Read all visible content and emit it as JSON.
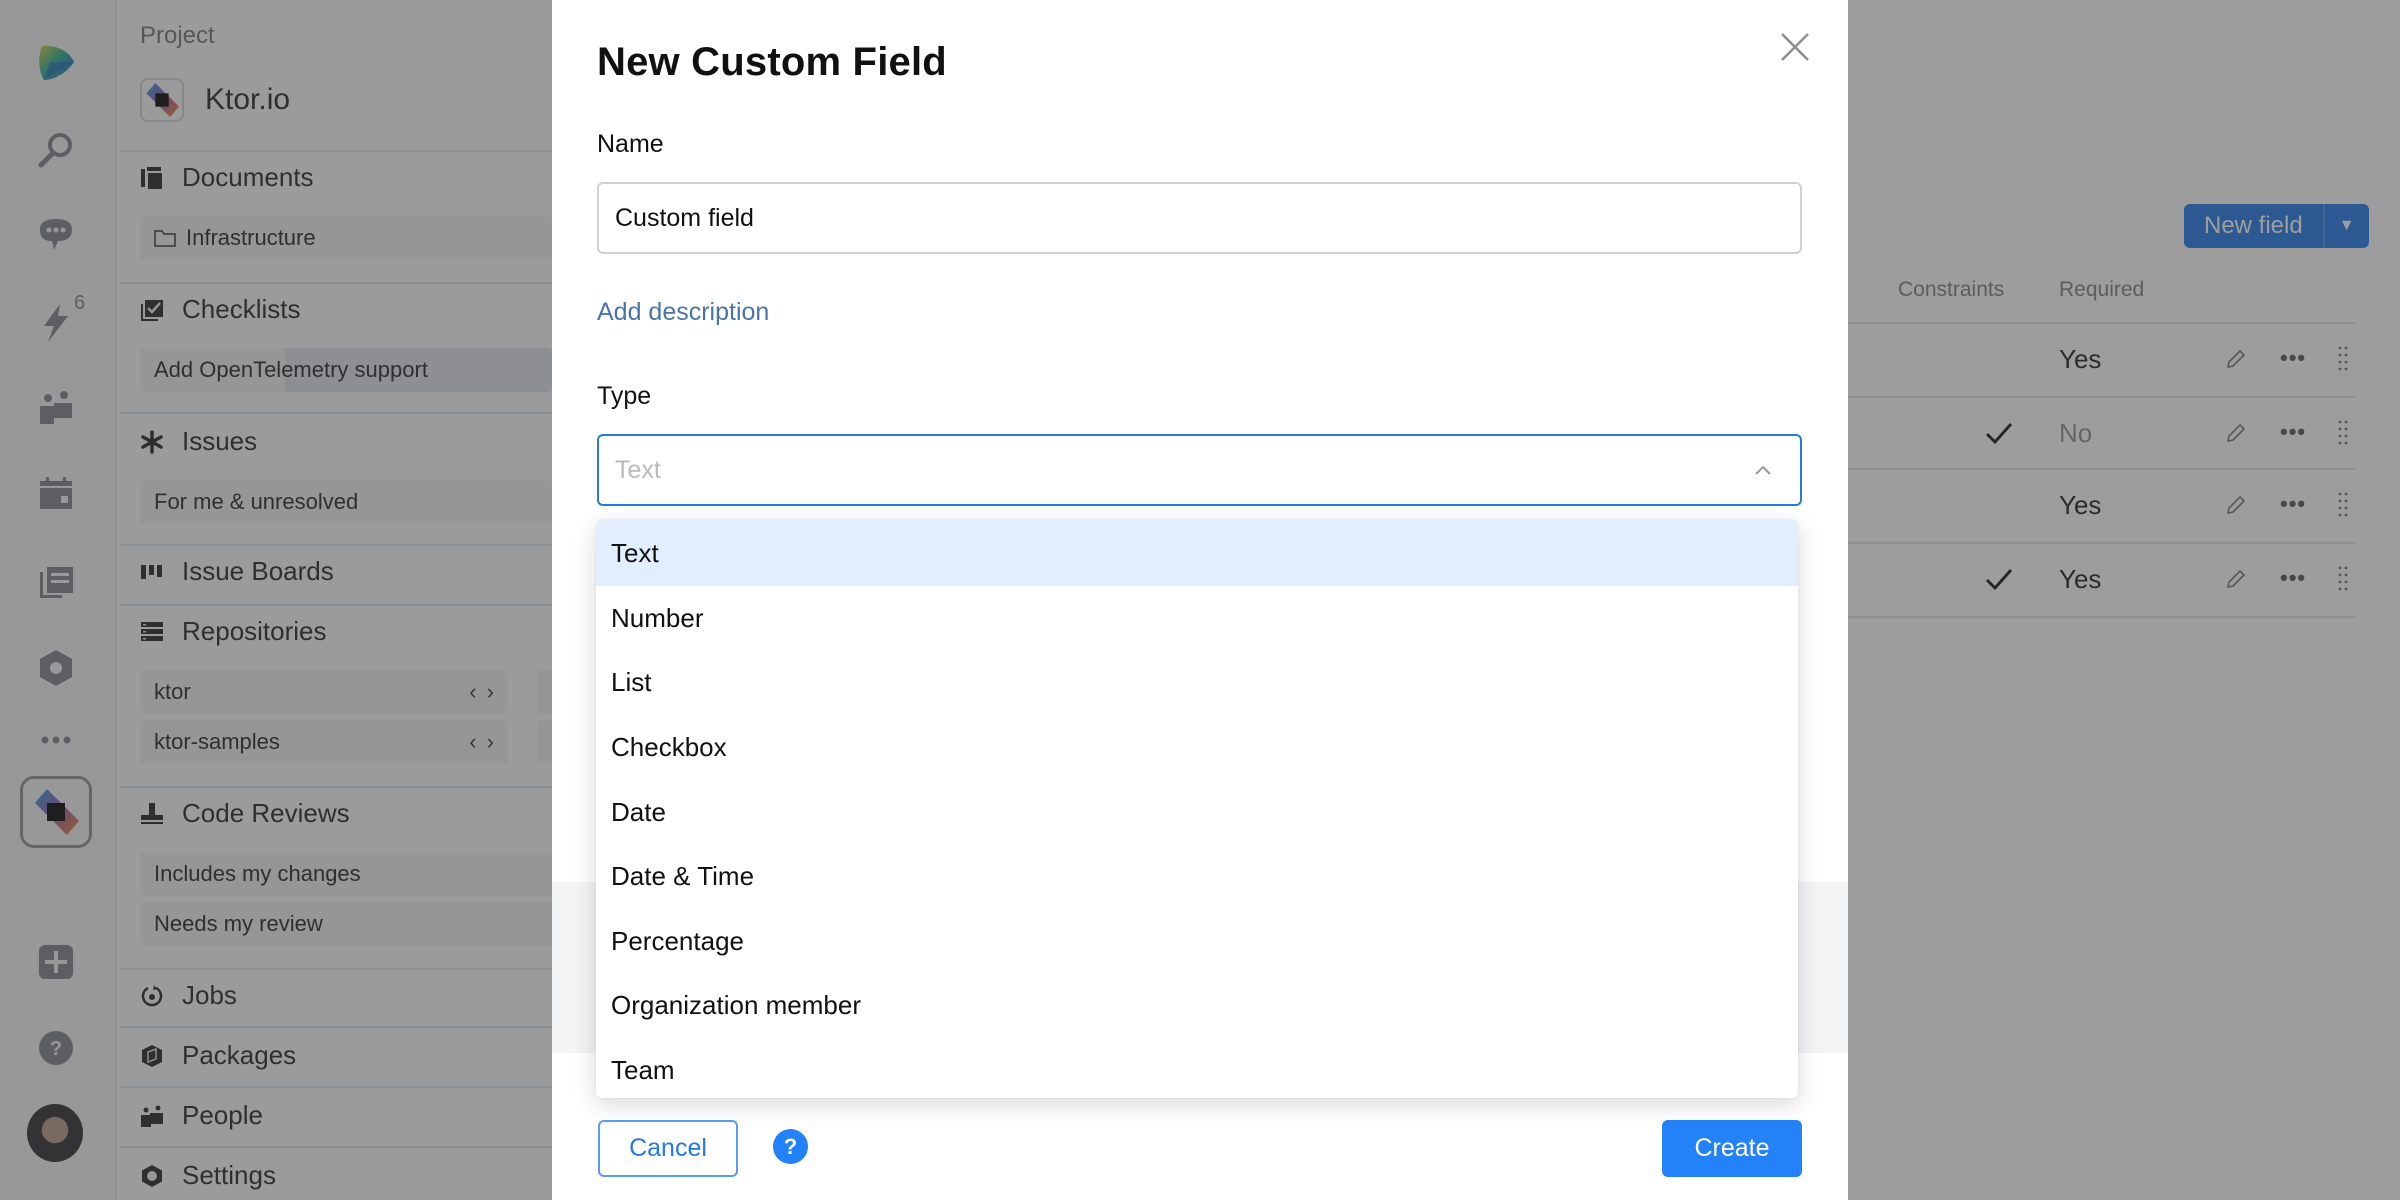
{
  "rail": {
    "notification_badge": "6",
    "icons": [
      "app-logo-icon",
      "search-icon",
      "chat-icon",
      "lightning-icon",
      "team-icon",
      "calendar-icon",
      "documents-icon",
      "settings-hex-icon",
      "more-icon",
      "project-icon",
      "plus-icon",
      "help-icon",
      "avatar"
    ]
  },
  "sidebar": {
    "project_label": "Project",
    "project_name": "Ktor.io",
    "sections": {
      "documents": {
        "label": "Documents",
        "items": [
          "Infrastructure"
        ]
      },
      "checklists": {
        "label": "Checklists",
        "items": [
          "Add OpenTelemetry support"
        ]
      },
      "issues": {
        "label": "Issues",
        "items": [
          "For me & unresolved"
        ]
      },
      "issue_boards": {
        "label": "Issue Boards"
      },
      "repositories": {
        "label": "Repositories",
        "items": [
          "ktor",
          "ktor-samples"
        ]
      },
      "code_reviews": {
        "label": "Code Reviews",
        "items": [
          "Includes my changes",
          "Needs my review"
        ]
      },
      "jobs": {
        "label": "Jobs"
      },
      "packages": {
        "label": "Packages"
      },
      "people": {
        "label": "People"
      },
      "settings": {
        "label": "Settings"
      }
    }
  },
  "content": {
    "new_field_button": "New field",
    "columns": {
      "constraints": "Constraints",
      "required": "Required"
    },
    "rows": [
      {
        "constraints": false,
        "required": "Yes"
      },
      {
        "constraints": true,
        "required": "No"
      },
      {
        "constraints": false,
        "required": "Yes"
      },
      {
        "constraints": true,
        "required": "Yes"
      }
    ],
    "row_more": "•••"
  },
  "modal": {
    "title": "New Custom Field",
    "name_label": "Name",
    "name_value": "Custom field",
    "add_description": "Add description",
    "type_label": "Type",
    "type_placeholder": "Text",
    "type_options": [
      "Text",
      "Number",
      "List",
      "Checkbox",
      "Date",
      "Date & Time",
      "Percentage",
      "Organization member",
      "Team"
    ],
    "type_highlighted": "Text",
    "cancel": "Cancel",
    "help": "?",
    "create": "Create"
  },
  "colors": {
    "accent": "#2382f7",
    "link": "#4a74a8",
    "focus_border": "#2a7ad6",
    "highlight": "#e1eefd"
  }
}
